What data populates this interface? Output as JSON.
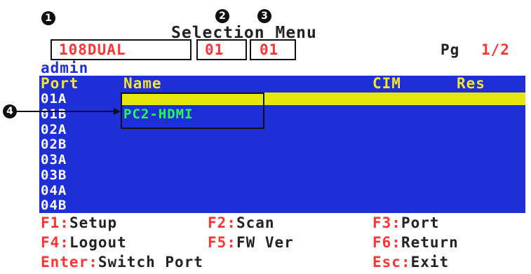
{
  "callouts": [
    "1",
    "2",
    "3",
    "4"
  ],
  "title": "Selection Menu",
  "info": {
    "device": "108DUAL",
    "field2": "01",
    "field3": "01",
    "page_label": "Pg",
    "page_value": "1/2"
  },
  "user": "admin",
  "columns": {
    "port": "Port",
    "name": "Name",
    "cim": "CIM",
    "res": "Res"
  },
  "ports": [
    {
      "id": "01A",
      "name": "",
      "selected": true
    },
    {
      "id": "01B",
      "name": "PC2-HDMI",
      "selected": false
    },
    {
      "id": "02A",
      "name": "",
      "selected": false
    },
    {
      "id": "02B",
      "name": "",
      "selected": false
    },
    {
      "id": "03A",
      "name": "",
      "selected": false
    },
    {
      "id": "03B",
      "name": "",
      "selected": false
    },
    {
      "id": "04A",
      "name": "",
      "selected": false
    },
    {
      "id": "04B",
      "name": "",
      "selected": false
    }
  ],
  "footer": [
    [
      {
        "key": "F1",
        "action": "Setup"
      },
      {
        "key": "F2",
        "action": "Scan"
      },
      {
        "key": "F3",
        "action": "Port"
      }
    ],
    [
      {
        "key": "F4",
        "action": "Logout"
      },
      {
        "key": "F5",
        "action": "FW Ver"
      },
      {
        "key": "F6",
        "action": "Return"
      }
    ],
    [
      {
        "key": "Enter",
        "action": "Switch Port"
      },
      {
        "key": "Esc",
        "action": "Exit"
      }
    ]
  ],
  "colors": {
    "list_bg": "#1f2fd8",
    "highlight": "#e7e60d",
    "header_text": "#f2e52a",
    "port_text": "#ffffff",
    "name_text": "#22ff44",
    "key_text": "#ff3333"
  }
}
